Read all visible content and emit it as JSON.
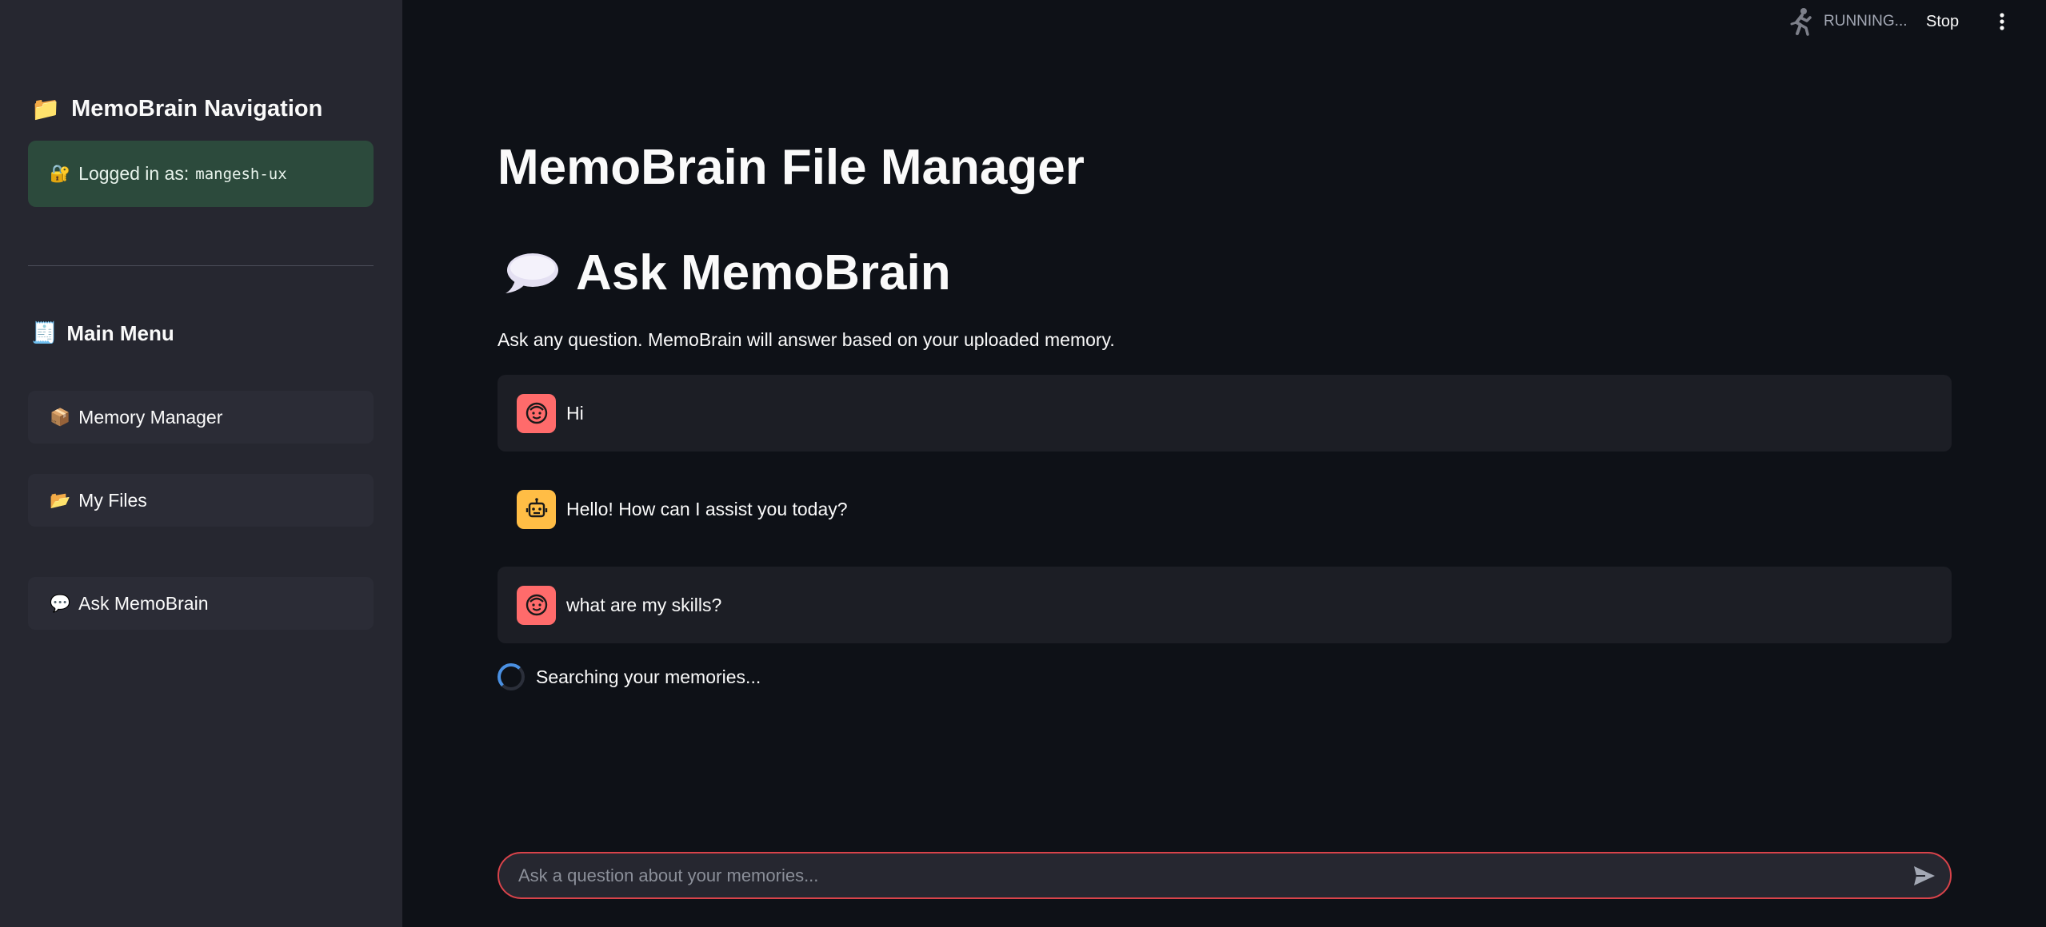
{
  "sidebar": {
    "heading_icon": "📁",
    "heading": "MemoBrain Navigation",
    "login": {
      "icon": "🔐",
      "label": "Logged in as:",
      "username": "mangesh-ux",
      "color": "#2c4a3c"
    },
    "menu_icon": "🧾",
    "menu_heading": "Main Menu",
    "items": [
      {
        "icon": "📦",
        "label": "Memory Manager"
      },
      {
        "icon": "📂",
        "label": "My Files"
      },
      {
        "icon": "💬",
        "label": "Ask MemoBrain"
      }
    ]
  },
  "topbar": {
    "status": "RUNNING...",
    "stop_label": "Stop",
    "status_icon": "running-man-icon",
    "menu_icon": "kebab-menu-icon"
  },
  "main": {
    "title": "MemoBrain File Manager",
    "section_icon": "speech-bubble-icon",
    "section_title": "Ask MemoBrain",
    "intro": "Ask any question. MemoBrain will answer based on your uploaded memory.",
    "messages": [
      {
        "role": "user",
        "avatar_icon": "user-face-icon",
        "text": "Hi"
      },
      {
        "role": "assistant",
        "avatar_icon": "robot-icon",
        "text": "Hello! How can I assist you today?"
      },
      {
        "role": "user",
        "avatar_icon": "user-face-icon",
        "text": "what are my skills?"
      }
    ],
    "spinner_text": "Searching your memories..."
  },
  "chat_input": {
    "placeholder": "Ask a question about your memories...",
    "value": "",
    "send_icon": "send-icon",
    "border_color": "#d8434a"
  },
  "colors": {
    "background": "#0e1117",
    "sidebar": "#262730",
    "user_avatar": "#ff6b6b",
    "bot_avatar": "#ffbd45",
    "spinner": "#4a90e2"
  }
}
